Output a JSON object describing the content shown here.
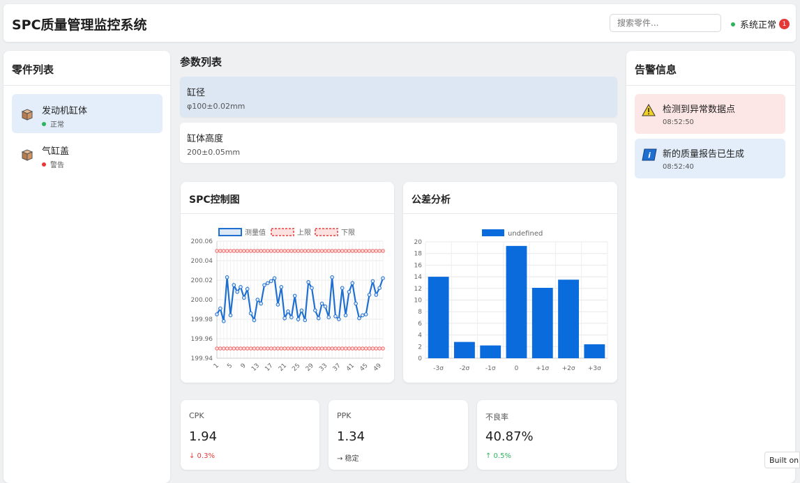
{
  "header": {
    "title": "SPC质量管理监控系统",
    "search_placeholder": "搜索零件...",
    "status_text": "系统正常",
    "notification_count": "1"
  },
  "parts_panel": {
    "title": "零件列表",
    "items": [
      {
        "name": "发动机缸体",
        "status": "正常",
        "status_color": "#2db35d",
        "icon": "cube-icon"
      },
      {
        "name": "气缸盖",
        "status": "警告",
        "status_color": "#e53935",
        "icon": "cube-icon"
      }
    ]
  },
  "params": {
    "title": "参数列表",
    "items": [
      {
        "name": "缸径",
        "spec": "φ100±0.02mm"
      },
      {
        "name": "缸体高度",
        "spec": "200±0.05mm"
      }
    ]
  },
  "spc_chart": {
    "title": "SPC控制图"
  },
  "tolerance_chart": {
    "title": "公差分析"
  },
  "chart_data": [
    {
      "type": "line",
      "legend": [
        "测量值",
        "上限",
        "下限"
      ],
      "legend_position": "top",
      "x": [
        1,
        2,
        3,
        4,
        5,
        6,
        7,
        8,
        9,
        10,
        11,
        12,
        13,
        14,
        15,
        16,
        17,
        18,
        19,
        20,
        21,
        22,
        23,
        24,
        25,
        26,
        27,
        28,
        29,
        30,
        31,
        32,
        33,
        34,
        35,
        36,
        37,
        38,
        39,
        40,
        41,
        42,
        43,
        44,
        45,
        46,
        47,
        48,
        49,
        50
      ],
      "x_ticks": [
        "1",
        "5",
        "9",
        "13",
        "17",
        "21",
        "25",
        "29",
        "33",
        "37",
        "41",
        "45",
        "49"
      ],
      "y_ticks": [
        "200.06",
        "200.04",
        "200.02",
        "200.00",
        "199.98",
        "199.96",
        "199.94"
      ],
      "series": [
        {
          "name": "测量值",
          "color": "#1f6fd1",
          "values": [
            199.985,
            199.991,
            199.978,
            200.023,
            199.984,
            200.015,
            200.008,
            200.013,
            200.002,
            200.011,
            199.986,
            199.979,
            200.0,
            199.996,
            200.015,
            200.017,
            200.019,
            200.022,
            199.995,
            200.013,
            199.981,
            199.988,
            199.982,
            200.004,
            199.98,
            199.989,
            199.979,
            200.018,
            200.012,
            199.989,
            199.981,
            199.996,
            199.993,
            199.982,
            200.023,
            199.983,
            199.98,
            200.012,
            199.984,
            200.008,
            200.017,
            199.996,
            199.981,
            199.984,
            199.985,
            200.005,
            200.019,
            200.005,
            200.012,
            200.022
          ]
        },
        {
          "name": "上限",
          "color": "#f06a6a",
          "values": [
            200.05,
            200.05,
            200.05,
            200.05,
            200.05,
            200.05,
            200.05,
            200.05,
            200.05,
            200.05,
            200.05,
            200.05,
            200.05,
            200.05,
            200.05,
            200.05,
            200.05,
            200.05,
            200.05,
            200.05,
            200.05,
            200.05,
            200.05,
            200.05,
            200.05,
            200.05,
            200.05,
            200.05,
            200.05,
            200.05,
            200.05,
            200.05,
            200.05,
            200.05,
            200.05,
            200.05,
            200.05,
            200.05,
            200.05,
            200.05,
            200.05,
            200.05,
            200.05,
            200.05,
            200.05,
            200.05,
            200.05,
            200.05,
            200.05,
            200.05
          ]
        },
        {
          "name": "下限",
          "color": "#f06a6a",
          "values": [
            199.95,
            199.95,
            199.95,
            199.95,
            199.95,
            199.95,
            199.95,
            199.95,
            199.95,
            199.95,
            199.95,
            199.95,
            199.95,
            199.95,
            199.95,
            199.95,
            199.95,
            199.95,
            199.95,
            199.95,
            199.95,
            199.95,
            199.95,
            199.95,
            199.95,
            199.95,
            199.95,
            199.95,
            199.95,
            199.95,
            199.95,
            199.95,
            199.95,
            199.95,
            199.95,
            199.95,
            199.95,
            199.95,
            199.95,
            199.95,
            199.95,
            199.95,
            199.95,
            199.95,
            199.95,
            199.95,
            199.95,
            199.95,
            199.95,
            199.95
          ]
        }
      ],
      "ylim": [
        199.94,
        200.06
      ],
      "grid": true
    },
    {
      "type": "bar",
      "legend": [
        "undefined"
      ],
      "legend_position": "top",
      "categories": [
        "-3σ",
        "-2σ",
        "-1σ",
        "0",
        "+1σ",
        "+2σ",
        "+3σ"
      ],
      "y_ticks": [
        "20",
        "18",
        "16",
        "14",
        "12",
        "10",
        "8",
        "6",
        "4",
        "2",
        "0"
      ],
      "series": [
        {
          "name": "undefined",
          "color": "#0a6bdc",
          "values": [
            14.0,
            2.8,
            2.2,
            19.3,
            12.1,
            13.5,
            2.4
          ]
        }
      ],
      "ylim": [
        0,
        20
      ],
      "grid": true
    }
  ],
  "stats": [
    {
      "label": "CPK",
      "value": "1.94",
      "trend": "↓ 0.3%",
      "trend_color": "#e53935"
    },
    {
      "label": "PPK",
      "value": "1.34",
      "trend": "→ 稳定",
      "trend_color": "#444444"
    },
    {
      "label": "不良率",
      "value": "40.87%",
      "trend": "↑ 0.5%",
      "trend_color": "#2db35d"
    }
  ],
  "alerts_panel": {
    "title": "告警信息",
    "items": [
      {
        "message": "检测到异常数据点",
        "time": "08:52:50",
        "icon": "warning-icon"
      },
      {
        "message": "新的质量报告已生成",
        "time": "08:52:40",
        "icon": "info-icon"
      }
    ]
  },
  "footer": {
    "built_on": "Built on"
  }
}
